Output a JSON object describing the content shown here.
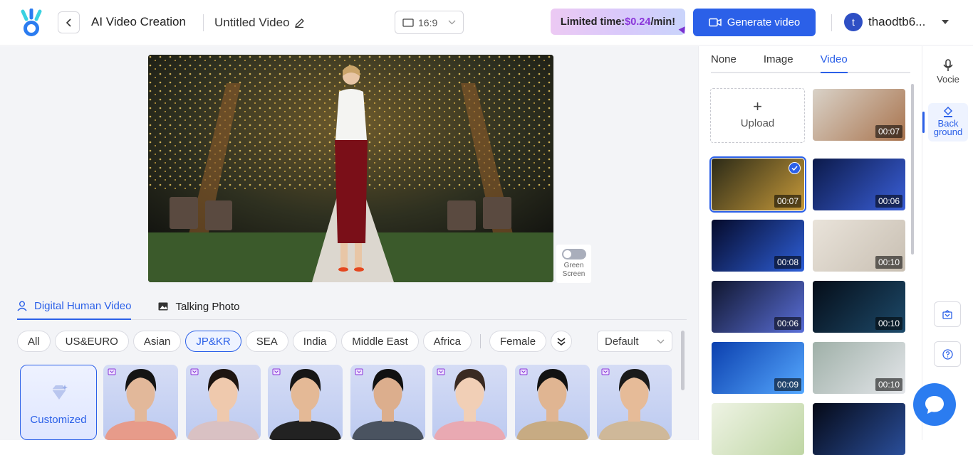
{
  "header": {
    "app_title": "AI Video Creation",
    "video_name": "Untitled Video",
    "aspect_ratio": "16:9",
    "promo_prefix": "Limited time: ",
    "promo_price": "$0.24",
    "promo_suffix": "/min!",
    "generate_label": "Generate video",
    "user_initial": "t",
    "username": "thaodtb6..."
  },
  "preview": {
    "green_screen_label_1": "Green",
    "green_screen_label_2": "Screen",
    "green_screen_on": false
  },
  "tabs": [
    {
      "label": "Digital Human Video",
      "active": true
    },
    {
      "label": "Talking Photo",
      "active": false
    }
  ],
  "filters": {
    "regions": [
      "All",
      "US&EURO",
      "Asian",
      "JP&KR",
      "SEA",
      "India",
      "Middle East",
      "Africa"
    ],
    "selected_region": "JP&KR",
    "gender": "Female",
    "sort": "Default"
  },
  "actors": {
    "customized_label": "Customized",
    "items": [
      {
        "shirt": "#e79b8a",
        "hair": "#141414",
        "skin": "#e2b89a"
      },
      {
        "shirt": "#d9c1c3",
        "hair": "#1e1511",
        "skin": "#efc9ad"
      },
      {
        "shirt": "#222222",
        "hair": "#161616",
        "skin": "#e4b996"
      },
      {
        "shirt": "#4a5360",
        "hair": "#111111",
        "skin": "#dcae8d"
      },
      {
        "shirt": "#e9a9b2",
        "hair": "#3a2a22",
        "skin": "#f1cfb6"
      },
      {
        "shirt": "#c7ab83",
        "hair": "#121212",
        "skin": "#e0b592"
      },
      {
        "shirt": "#cfb899",
        "hair": "#1a1a1a",
        "skin": "#e6bb98"
      }
    ]
  },
  "background_panel": {
    "tabs": [
      "None",
      "Image",
      "Video"
    ],
    "active_tab": "Video",
    "upload_label": "Upload",
    "videos": [
      {
        "duration": "00:07",
        "theme": "office",
        "selected": false
      },
      {
        "duration": "00:07",
        "theme": "garden-lights",
        "selected": true
      },
      {
        "duration": "00:06",
        "theme": "studio",
        "selected": false
      },
      {
        "duration": "00:08",
        "theme": "planet",
        "selected": false
      },
      {
        "duration": "00:10",
        "theme": "empty-room",
        "selected": false
      },
      {
        "duration": "00:06",
        "theme": "newsroom",
        "selected": false
      },
      {
        "duration": "00:10",
        "theme": "globe",
        "selected": false
      },
      {
        "duration": "00:09",
        "theme": "news",
        "selected": false
      },
      {
        "duration": "00:10",
        "theme": "wedding-arch",
        "selected": false
      },
      {
        "duration": "",
        "theme": "leaves",
        "selected": false
      },
      {
        "duration": "",
        "theme": "earth",
        "selected": false
      }
    ]
  },
  "rail": {
    "voice_label": "Vocie",
    "background_label_1": "Back",
    "background_label_2": "ground"
  },
  "colors": {
    "accent": "#2b60e8",
    "promo_price": "#8a35d9"
  }
}
